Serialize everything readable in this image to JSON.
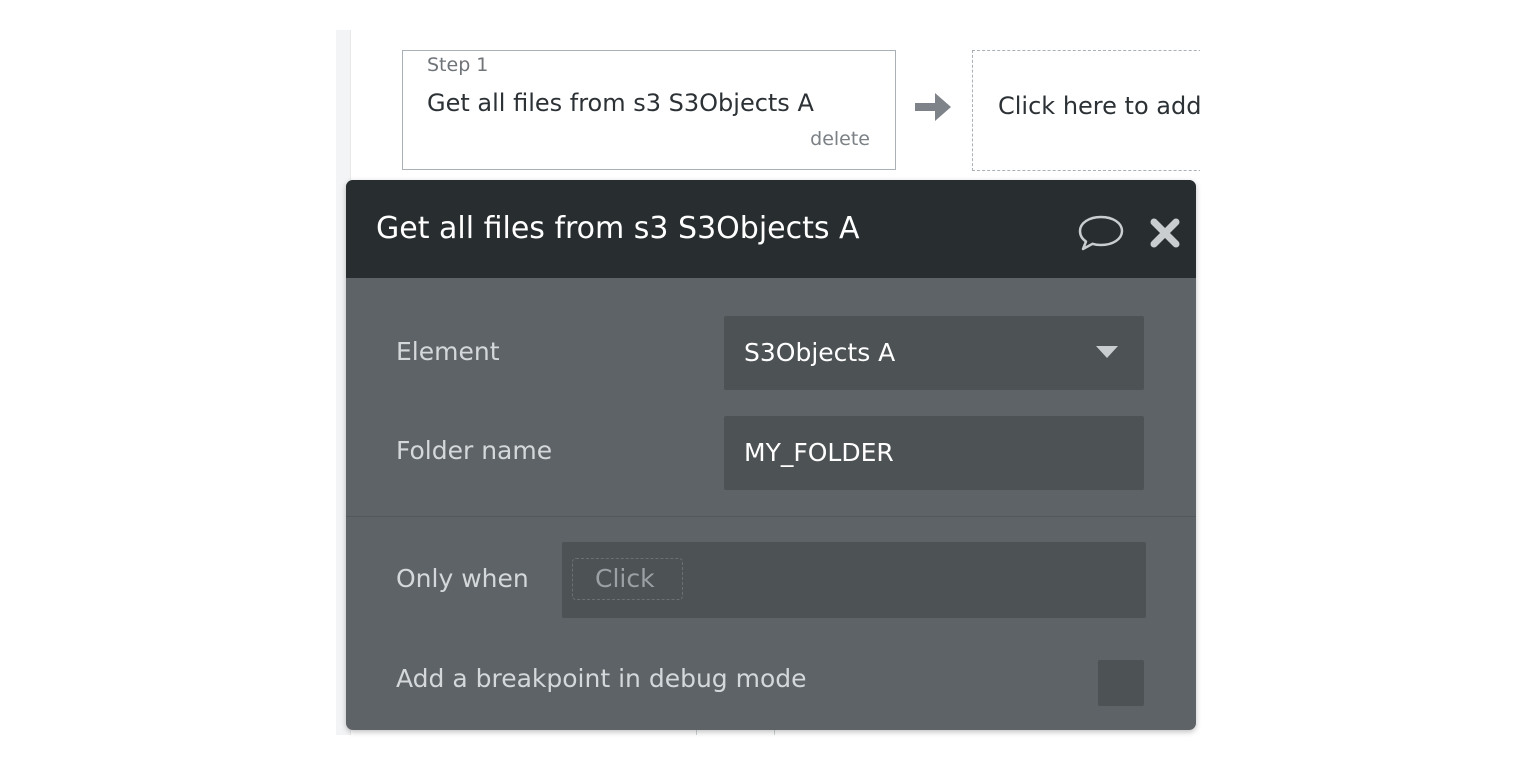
{
  "workflow": {
    "step": {
      "label": "Step 1",
      "title": "Get all files from s3 S3Objects A",
      "delete_label": "delete"
    },
    "add_action_text": "Click here to add an action..."
  },
  "panel": {
    "title": "Get all files from s3 S3Objects A",
    "element": {
      "label": "Element",
      "value": "S3Objects A"
    },
    "folder_name": {
      "label": "Folder name",
      "value": "MY_FOLDER"
    },
    "only_when": {
      "label": "Only when",
      "placeholder": "Click"
    },
    "breakpoint": {
      "label": "Add a breakpoint in debug mode",
      "checked": false
    }
  },
  "colors": {
    "panel_header_bg": "#282e30",
    "panel_body_bg": "#5e6367",
    "field_bg": "#4d5255",
    "text_primary": "#ffffff",
    "text_label": "#d4d8da"
  },
  "icons": [
    "arrow-right-icon",
    "comment-icon",
    "close-icon",
    "chevron-down-icon"
  ]
}
